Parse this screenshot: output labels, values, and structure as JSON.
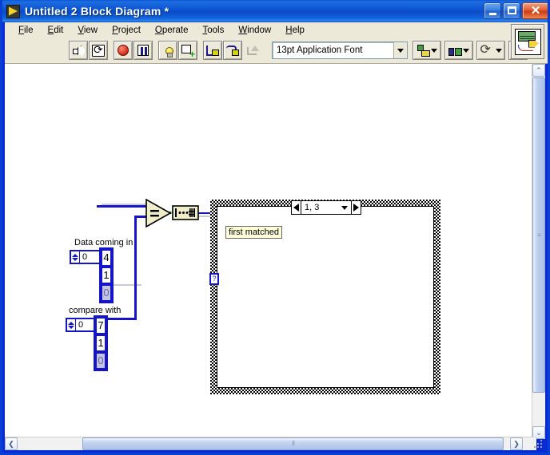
{
  "window": {
    "title": "Untitled 2 Block Diagram *",
    "icon": "labview-vi-icon",
    "minimize_label": "",
    "maximize_label": "",
    "close_label": "✕"
  },
  "menubar": {
    "items": [
      {
        "label": "File",
        "accel": "F"
      },
      {
        "label": "Edit",
        "accel": "E"
      },
      {
        "label": "View",
        "accel": "V"
      },
      {
        "label": "Project",
        "accel": "P"
      },
      {
        "label": "Operate",
        "accel": "O"
      },
      {
        "label": "Tools",
        "accel": "T"
      },
      {
        "label": "Window",
        "accel": "W"
      },
      {
        "label": "Help",
        "accel": "H"
      }
    ]
  },
  "toolbar": {
    "buttons": [
      {
        "name": "run-button",
        "icon": "run-arrow-icon"
      },
      {
        "name": "run-continuously-button",
        "icon": "run-continuously-icon"
      },
      {
        "name": "abort-execution-button",
        "icon": "abort-stop-icon"
      },
      {
        "name": "pause-button",
        "icon": "pause-icon"
      },
      {
        "name": "highlight-execution-button",
        "icon": "lightbulb-icon"
      },
      {
        "name": "retain-wire-values-button",
        "icon": "probe-icon"
      },
      {
        "name": "step-into-button",
        "icon": "step-into-icon"
      },
      {
        "name": "step-over-button",
        "icon": "step-over-icon"
      },
      {
        "name": "step-out-button",
        "icon": "step-out-icon"
      }
    ],
    "font_selector": {
      "value": "13pt Application Font",
      "dropdown_icon": "chevron-down-icon"
    },
    "align_objects": {
      "icon": "align-objects-icon",
      "dropdown_icon": "chevron-down-icon"
    },
    "distribute_objects": {
      "icon": "distribute-objects-icon",
      "dropdown_icon": "chevron-down-icon"
    },
    "reorder": {
      "icon": "reorder-icon",
      "dropdown_icon": "chevron-down-icon"
    },
    "cleanup_diagram": {
      "icon": "cleanup-diagram-icon"
    },
    "context_help": {
      "icon": "question-mark-icon"
    },
    "vi_icon": {
      "icon": "vi-connector-pane-icon"
    }
  },
  "diagram": {
    "controls": [
      {
        "name": "data-coming-in",
        "label": "Data coming in",
        "index_value": "0",
        "spinner_icon": "spinner-arrows-icon",
        "elements": [
          "4",
          "1",
          "0"
        ],
        "dim_last": true
      },
      {
        "name": "compare-with",
        "label": "compare with",
        "index_value": "0",
        "spinner_icon": "spinner-arrows-icon",
        "elements": [
          "7",
          "1",
          "0"
        ],
        "dim_last": true
      }
    ],
    "nodes": [
      {
        "name": "equal-comparison-node",
        "glyph": "="
      },
      {
        "name": "search-1d-array-node",
        "glyph": "[•••]#"
      }
    ],
    "case_structure": {
      "name": "case-structure",
      "selector_value": "1, 3",
      "left_arrow_icon": "arrow-left-icon",
      "right_arrow_icon": "arrow-right-icon",
      "dropdown_icon": "chevron-down-icon",
      "tunnel_glyph": "?",
      "free_label": "first matched"
    }
  },
  "scrollbars": {
    "vertical": {
      "up_glyph": "⌃",
      "down_glyph": "⌄",
      "grip_glyph": "≡"
    },
    "horizontal": {
      "left_glyph": "❮",
      "right_glyph": "❯",
      "grip_glyph": "⦀"
    }
  },
  "colors": {
    "titlebar_blue": "#0a4bc8",
    "chrome_beige": "#ece9d8",
    "wire_blue": "#1414c8",
    "node_tan": "#f0eec8",
    "label_yellow": "#fffdd8",
    "canvas_white": "#ffffff"
  }
}
